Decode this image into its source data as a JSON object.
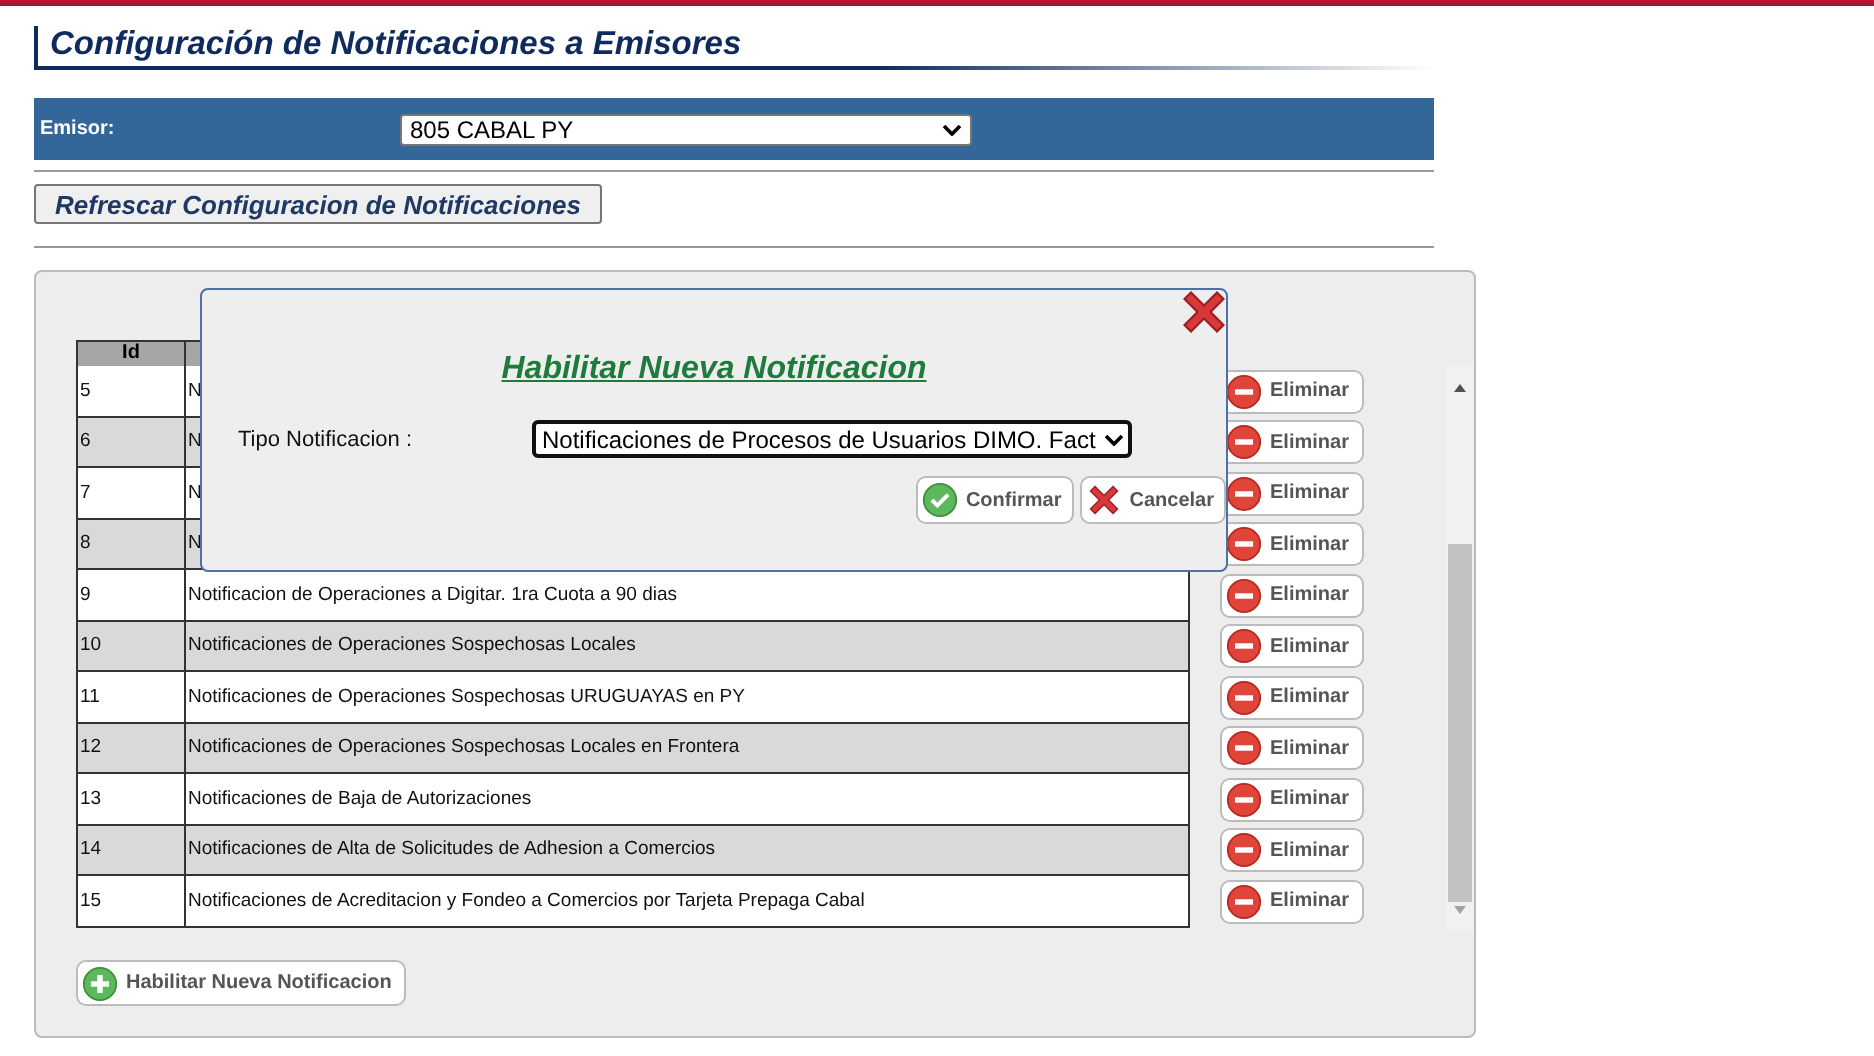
{
  "page": {
    "title": "Configuración de Notificaciones a Emisores"
  },
  "emisor": {
    "label": "Emisor:",
    "value": "805 CABAL PY"
  },
  "refresh_button": "Refrescar Configuracion de Notificaciones",
  "table": {
    "columns": [
      "Id"
    ],
    "rows": [
      {
        "id": "5",
        "description": "N",
        "action": "Eliminar"
      },
      {
        "id": "6",
        "description": "N",
        "action": "Eliminar"
      },
      {
        "id": "7",
        "description": "N",
        "action": "Eliminar"
      },
      {
        "id": "8",
        "description": "N",
        "action": "Eliminar"
      },
      {
        "id": "9",
        "description": "Notificacion de Operaciones a Digitar. 1ra Cuota a 90 dias",
        "action": "Eliminar"
      },
      {
        "id": "10",
        "description": "Notificaciones de Operaciones Sospechosas Locales",
        "action": "Eliminar"
      },
      {
        "id": "11",
        "description": "Notificaciones de Operaciones Sospechosas URUGUAYAS en PY",
        "action": "Eliminar"
      },
      {
        "id": "12",
        "description": "Notificaciones de Operaciones Sospechosas Locales en Frontera",
        "action": "Eliminar"
      },
      {
        "id": "13",
        "description": "Notificaciones de Baja de Autorizaciones",
        "action": "Eliminar"
      },
      {
        "id": "14",
        "description": "Notificaciones de Alta de Solicitudes de Adhesion a Comercios",
        "action": "Eliminar"
      },
      {
        "id": "15",
        "description": "Notificaciones de Acreditacion y Fondeo a Comercios por Tarjeta Prepaga Cabal",
        "action": "Eliminar"
      }
    ]
  },
  "add_button": "Habilitar Nueva Notificacion",
  "dialog": {
    "title": "Habilitar Nueva Notificacion",
    "field_label": "Tipo Notificacion :",
    "field_value": "Notificaciones de Procesos de Usuarios DIMO. Fact",
    "buttons": [
      {
        "kind": "confirm",
        "label": "Confirmar"
      },
      {
        "kind": "cancel",
        "label": "Cancelar"
      }
    ]
  }
}
